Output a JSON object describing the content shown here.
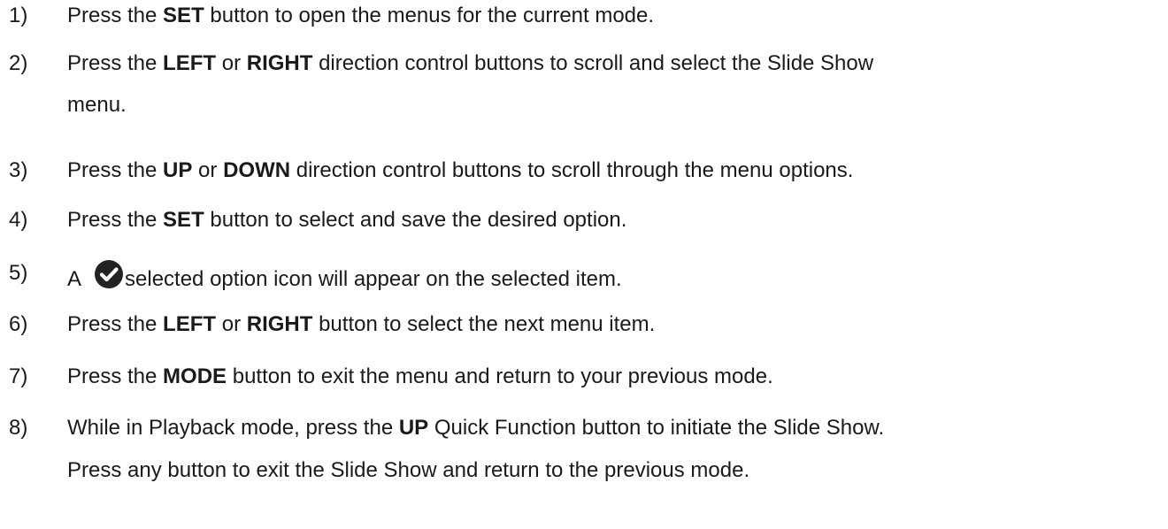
{
  "steps": [
    {
      "num": "1)",
      "parts": [
        {
          "t": "Press the ",
          "b": false
        },
        {
          "t": "SET",
          "b": true
        },
        {
          "t": " button to open the menus for the current mode.",
          "b": false
        }
      ]
    },
    {
      "num": "2)",
      "parts": [
        {
          "t": "Press the ",
          "b": false
        },
        {
          "t": "LEFT",
          "b": true
        },
        {
          "t": " or ",
          "b": false
        },
        {
          "t": "RIGHT",
          "b": true
        },
        {
          "t": " direction control buttons to scroll and select the Slide Show",
          "b": false
        }
      ],
      "continuation": "menu."
    },
    {
      "num": "3)",
      "parts": [
        {
          "t": "Press the ",
          "b": false
        },
        {
          "t": "UP",
          "b": true
        },
        {
          "t": " or ",
          "b": false
        },
        {
          "t": "DOWN",
          "b": true
        },
        {
          "t": " direction control buttons to scroll through the menu options.",
          "b": false
        }
      ]
    },
    {
      "num": "4)",
      "parts": [
        {
          "t": "Press the ",
          "b": false
        },
        {
          "t": "SET",
          "b": true
        },
        {
          "t": " button to select and save the desired option.",
          "b": false
        }
      ]
    },
    {
      "num": "5)",
      "before_icon": "A",
      "icon": "check-circle-icon",
      "after_icon": "selected option icon will appear on the selected item."
    },
    {
      "num": "6)",
      "parts": [
        {
          "t": "Press the ",
          "b": false
        },
        {
          "t": "LEFT",
          "b": true
        },
        {
          "t": " or ",
          "b": false
        },
        {
          "t": "RIGHT",
          "b": true
        },
        {
          "t": " button to select the next menu item.",
          "b": false
        }
      ]
    },
    {
      "num": "7)",
      "parts": [
        {
          "t": "Press the ",
          "b": false
        },
        {
          "t": "MODE",
          "b": true
        },
        {
          "t": " button to exit the menu and return to your previous mode.",
          "b": false
        }
      ]
    },
    {
      "num": "8)",
      "parts": [
        {
          "t": "While in Playback mode, press the ",
          "b": false
        },
        {
          "t": "UP",
          "b": true
        },
        {
          "t": " Quick Function button to initiate the Slide Show.",
          "b": false
        }
      ],
      "continuation": "Press any button to exit the Slide Show and return to the previous mode."
    }
  ]
}
